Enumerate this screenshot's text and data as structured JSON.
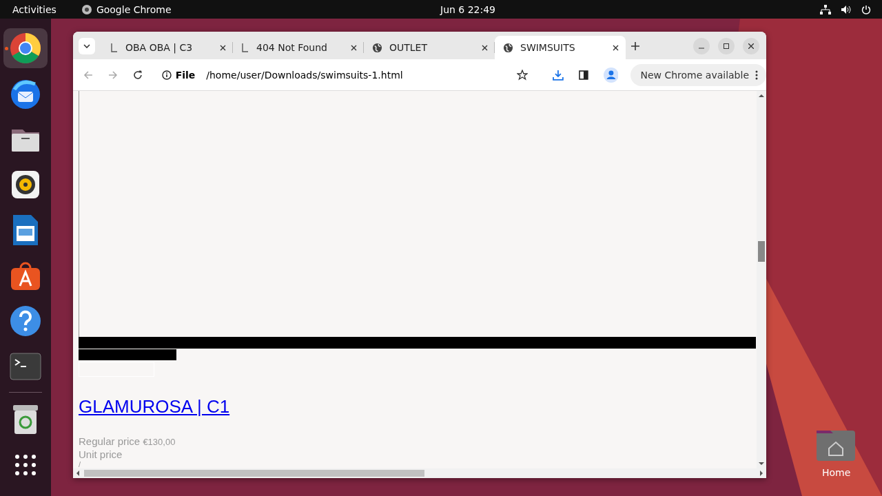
{
  "topbar": {
    "activities": "Activities",
    "app": "Google Chrome",
    "clock": "Jun 6  22:49"
  },
  "dock": [
    {
      "kind": "chrome",
      "running": true
    },
    {
      "kind": "mail",
      "running": false
    },
    {
      "kind": "files",
      "running": false
    },
    {
      "kind": "speaker",
      "running": false
    },
    {
      "kind": "document",
      "running": false
    },
    {
      "kind": "store",
      "running": false
    },
    {
      "kind": "help",
      "running": false
    },
    {
      "kind": "terminal",
      "running": false
    },
    {
      "kind": "trash",
      "running": false
    },
    {
      "kind": "apps",
      "running": false
    }
  ],
  "browser": {
    "tabs": [
      {
        "title": "OBA OBA | C3",
        "kind": "page",
        "selected": false
      },
      {
        "title": "404 Not Found",
        "kind": "page",
        "selected": false
      },
      {
        "title": "OUTLET",
        "kind": "globe",
        "selected": false
      },
      {
        "title": "SWIMSUITS",
        "kind": "globe",
        "selected": true
      }
    ],
    "address": {
      "scheme": "File",
      "url": "/home/user/Downloads/swimsuits-1.html"
    },
    "update": "New Chrome available"
  },
  "page": {
    "product_title": "GLAMUROSA | C1",
    "price_label": "Regular price",
    "price": "€130,00",
    "unit_price": "Unit price",
    "separator": "/"
  },
  "desktop": {
    "home": "Home"
  }
}
